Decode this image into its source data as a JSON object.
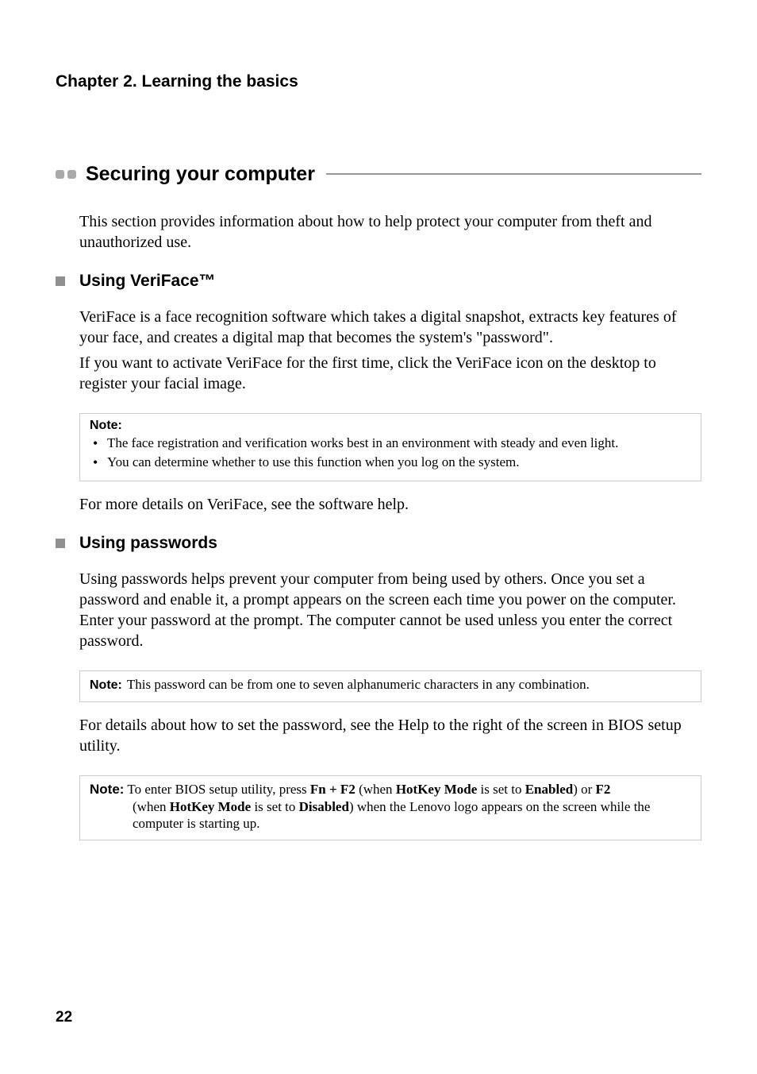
{
  "chapter_header": "Chapter 2. Learning the basics",
  "section_title": "Securing your computer",
  "intro_text": "This section provides information about how to help protect your computer from theft and unauthorized use.",
  "subsection1": {
    "title": "Using VeriFace™",
    "para1": "VeriFace is a face recognition software which takes a digital snapshot, extracts key features of your face, and creates a digital map that becomes the system's \"password\".",
    "para2": "If you want to activate VeriFace for the first time, click the VeriFace icon on the desktop to register your facial image.",
    "note_label": "Note:",
    "note_items": [
      "The face registration and verification works best in an environment with steady and even light.",
      "You can determine whether to use this function when you log on the system."
    ],
    "para3": "For more details on VeriFace, see the software help."
  },
  "subsection2": {
    "title": "Using passwords",
    "para1": "Using passwords helps prevent your computer from being used by others. Once you set a password and enable it, a prompt appears on the screen each time you power on the computer. Enter your password at the prompt. The computer cannot be used unless you enter the correct password.",
    "note1_label": "Note:",
    "note1_text": "This password can be from one to seven alphanumeric characters in any combination.",
    "para2": "For details about how to set the password, see the Help to the right of the screen in BIOS setup utility.",
    "note2_label": "Note:",
    "note2_pre": "To enter BIOS setup utility, press ",
    "note2_bold1": "Fn + F2",
    "note2_mid1": " (when ",
    "note2_bold2": "HotKey Mode",
    "note2_mid2": " is set to ",
    "note2_bold3": "Enabled",
    "note2_mid3": ") or ",
    "note2_bold4": "F2",
    "note2_mid4": " (when ",
    "note2_bold5": "HotKey Mode",
    "note2_mid5": " is set to ",
    "note2_bold6": "Disabled",
    "note2_post": ") when the Lenovo logo appears on the screen while the computer is starting up."
  },
  "page_number": "22"
}
